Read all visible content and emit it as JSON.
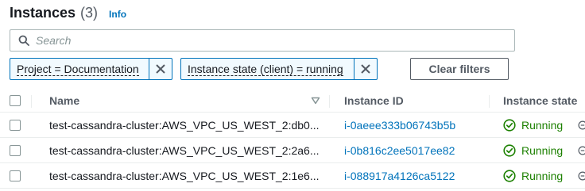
{
  "header": {
    "title": "Instances",
    "count": "(3)",
    "info_label": "Info"
  },
  "search": {
    "placeholder": "Search",
    "value": ""
  },
  "filters": [
    {
      "label": "Project = Documentation"
    },
    {
      "label": "Instance state (client) = running"
    }
  ],
  "clear_filters_label": "Clear filters",
  "table": {
    "columns": {
      "name": "Name",
      "instance_id": "Instance ID",
      "instance_state": "Instance state"
    },
    "rows": [
      {
        "name": "test-cassandra-cluster:AWS_VPC_US_WEST_2:db0...",
        "instance_id": "i-0aeee333b06743b5b",
        "state": "Running"
      },
      {
        "name": "test-cassandra-cluster:AWS_VPC_US_WEST_2:2a6...",
        "instance_id": "i-0b816c2ee5017ee82",
        "state": "Running"
      },
      {
        "name": "test-cassandra-cluster:AWS_VPC_US_WEST_2:1e6...",
        "instance_id": "i-088917a4126ca5122",
        "state": "Running"
      }
    ]
  },
  "colors": {
    "link": "#0073bb",
    "running": "#1d8102",
    "token_border": "#0073bb",
    "token_bg": "#f1faff"
  },
  "icons": {
    "search": "search-icon",
    "close": "close-icon",
    "sort": "sort-down-icon",
    "status": "check-circle-icon",
    "zoom": "zoom-icon"
  }
}
